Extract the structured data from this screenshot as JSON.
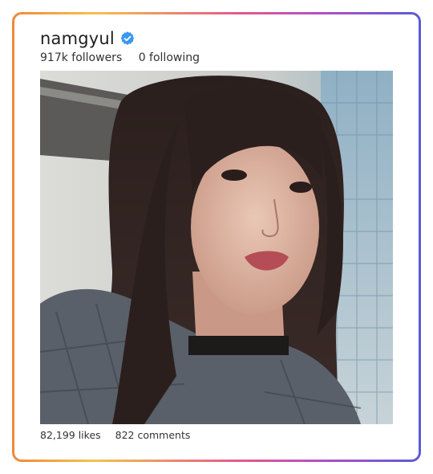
{
  "profile": {
    "username": "namgyul",
    "verified_icon": "verified-badge-icon",
    "followers": "917k followers",
    "following": "0 following"
  },
  "post": {
    "image_description_icon": "photo",
    "likes": "82,199 likes",
    "comments": "822 comments"
  },
  "colors": {
    "border_gradient": [
      "#f0883a",
      "#f4c24a",
      "#e55a8a",
      "#b54fc4",
      "#5b5bd6"
    ],
    "verified_blue": "#3897f0"
  }
}
